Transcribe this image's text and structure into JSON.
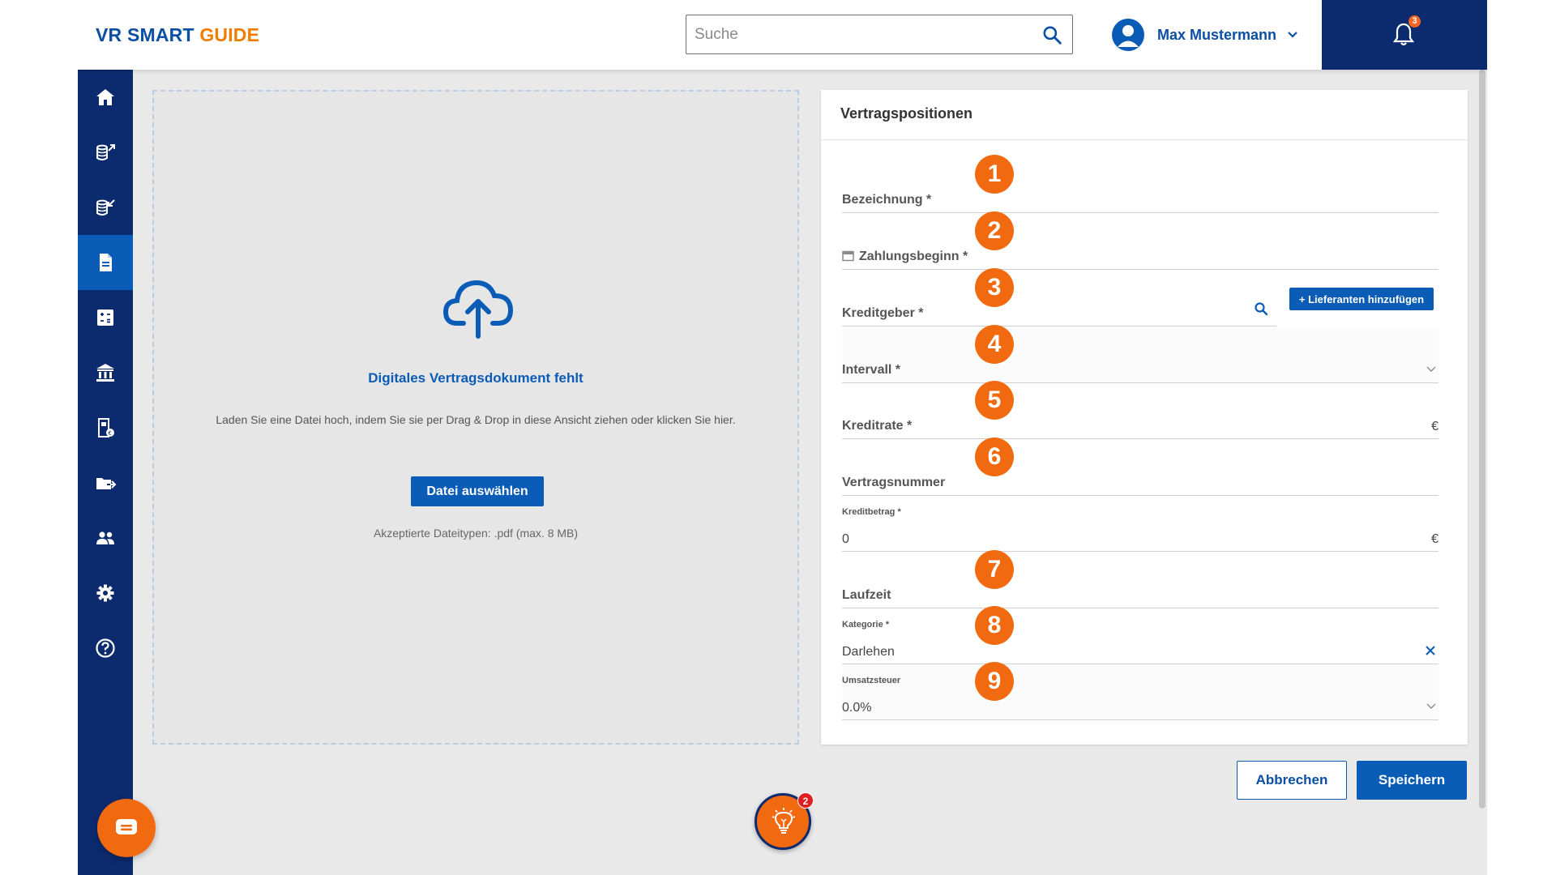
{
  "app": {
    "logo_part1": "VR SMART",
    "logo_part2": "GUIDE"
  },
  "search": {
    "placeholder": "Suche"
  },
  "user": {
    "name": "Max Mustermann"
  },
  "notifications": {
    "count": "3"
  },
  "sidebar": {
    "items": [
      {
        "icon": "home-icon"
      },
      {
        "icon": "outgoing-payments-icon"
      },
      {
        "icon": "incoming-payments-icon"
      },
      {
        "icon": "contract-document-icon",
        "active": true
      },
      {
        "icon": "calculator-icon"
      },
      {
        "icon": "bank-icon"
      },
      {
        "icon": "tax-document-icon"
      },
      {
        "icon": "folder-export-icon"
      },
      {
        "icon": "users-icon"
      },
      {
        "icon": "settings-icon"
      },
      {
        "icon": "help-icon"
      }
    ]
  },
  "upload": {
    "title": "Digitales Vertragsdokument fehlt",
    "description": "Laden Sie eine Datei hoch, indem Sie sie per Drag & Drop in diese Ansicht ziehen oder klicken Sie hier.",
    "button": "Datei auswählen",
    "accepted": "Akzeptierte Dateitypen: .pdf (max. 8 MB)"
  },
  "form": {
    "title": "Vertragspositionen",
    "fields": {
      "bezeichnung": {
        "label": "Bezeichnung *",
        "marker": "1"
      },
      "zahlungsbeginn": {
        "label": "Zahlungsbeginn *",
        "marker": "2"
      },
      "kreditgeber": {
        "label": "Kreditgeber *",
        "marker": "3",
        "add_button": "+ Lieferanten hinzufügen"
      },
      "intervall": {
        "label": "Intervall *",
        "marker": "4"
      },
      "kreditrate": {
        "label": "Kreditrate *",
        "marker": "5",
        "suffix": "€"
      },
      "vertragsnummer": {
        "label": "Vertragsnummer",
        "marker": "6"
      },
      "kreditbetrag": {
        "label": "Kreditbetrag *",
        "value": "0",
        "suffix": "€"
      },
      "laufzeit": {
        "label": "Laufzeit",
        "marker": "7"
      },
      "kategorie": {
        "label": "Kategorie *",
        "value": "Darlehen",
        "marker": "8"
      },
      "umsatzsteuer": {
        "label": "Umsatzsteuer",
        "value": "0.0%",
        "marker": "9"
      }
    }
  },
  "actions": {
    "cancel": "Abbrechen",
    "save": "Speichern"
  },
  "hint": {
    "count": "2"
  },
  "colors": {
    "primary": "#0a5cb6",
    "navy": "#0c2a6e",
    "accent": "#f07c00",
    "marker": "#f26a10"
  }
}
